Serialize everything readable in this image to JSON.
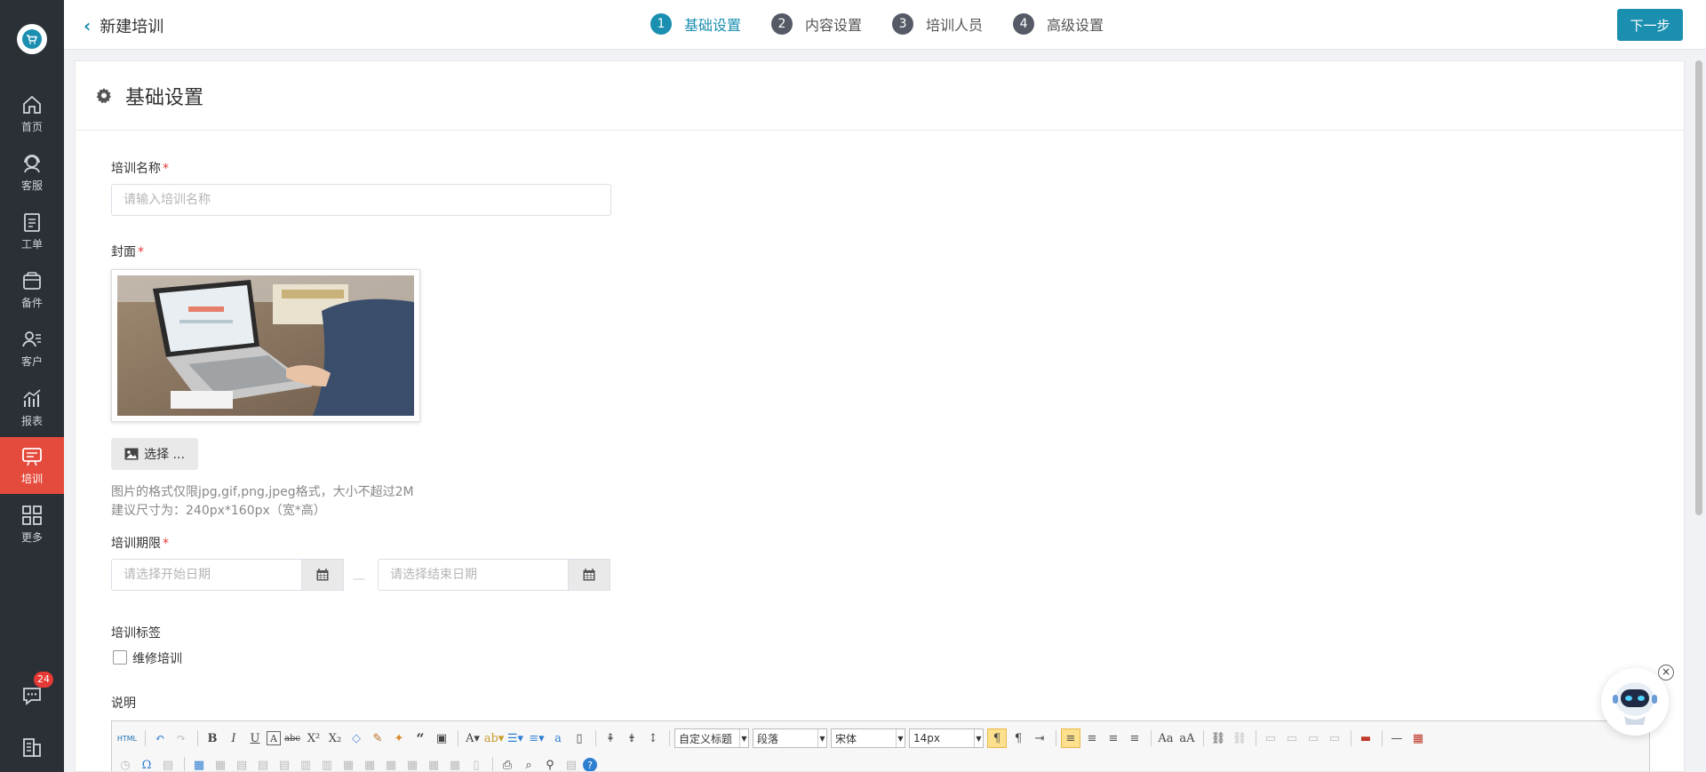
{
  "sidebar": {
    "items": [
      {
        "label": "首页",
        "icon": "home-icon"
      },
      {
        "label": "客服",
        "icon": "headset-icon"
      },
      {
        "label": "工单",
        "icon": "clipboard-icon"
      },
      {
        "label": "备件",
        "icon": "box-icon"
      },
      {
        "label": "客户",
        "icon": "user-list-icon"
      },
      {
        "label": "报表",
        "icon": "chart-icon"
      },
      {
        "label": "培训",
        "icon": "training-icon"
      },
      {
        "label": "更多",
        "icon": "grid-icon"
      }
    ],
    "message_badge": "24"
  },
  "header": {
    "title": "新建培训",
    "steps": [
      {
        "num": "1",
        "label": "基础设置"
      },
      {
        "num": "2",
        "label": "内容设置"
      },
      {
        "num": "3",
        "label": "培训人员"
      },
      {
        "num": "4",
        "label": "高级设置"
      }
    ],
    "next_label": "下一步"
  },
  "card": {
    "title": "基础设置"
  },
  "form": {
    "name_label": "培训名称",
    "name_placeholder": "请输入培训名称",
    "cover_label": "封面",
    "select_label": "选择 ...",
    "hint1": "图片的格式仅限jpg,gif,png,jpeg格式，大小不超过2M",
    "hint2": "建议尺寸为：240px*160px（宽*高）",
    "period_label": "培训期限",
    "start_placeholder": "请选择开始日期",
    "end_placeholder": "请选择结束日期",
    "tags_label": "培训标签",
    "tag_option": "维修培训",
    "desc_label": "说明"
  },
  "editor": {
    "custom_title": "自定义标题",
    "paragraph": "段落",
    "font": "宋体",
    "size": "14px",
    "html_label": "HTML"
  },
  "colors": {
    "accent": "#1a8fb0",
    "sidebar_bg": "#2b2f36",
    "active_nav": "#e54b3c"
  }
}
